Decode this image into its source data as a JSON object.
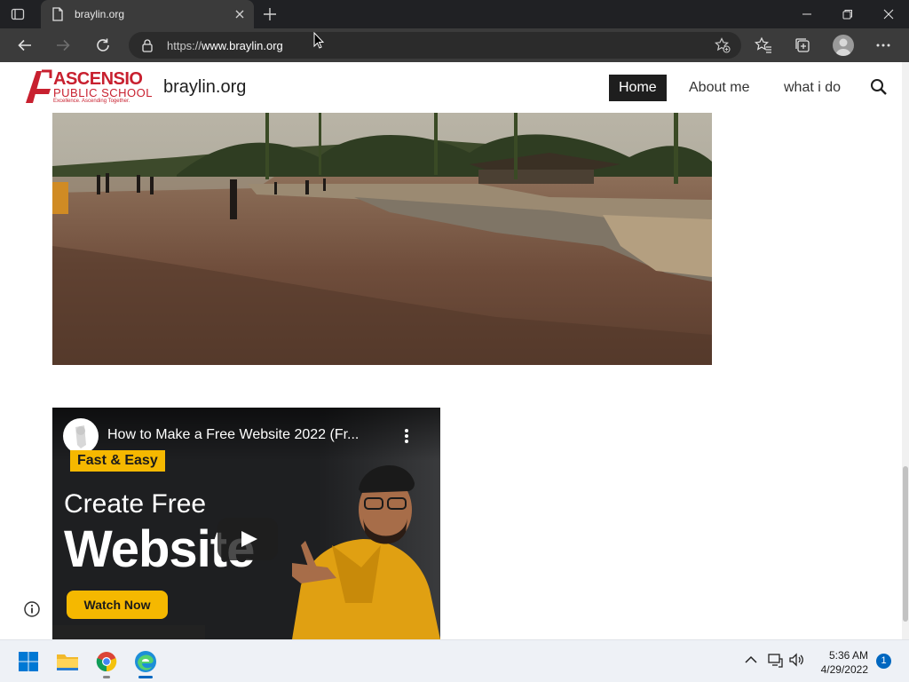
{
  "browser": {
    "tab_title": "braylin.org",
    "url_prefix": "https://",
    "url_host": "www.braylin.org"
  },
  "site": {
    "logo_line1": "ASCENSIO",
    "logo_line2": "PUBLIC SCHOOL",
    "logo_tagline": "Excellence. Ascending Together.",
    "title": "braylin.org",
    "nav": [
      {
        "label": "Home",
        "active": true
      },
      {
        "label": "About me",
        "active": false
      },
      {
        "label": "what i do",
        "active": false
      }
    ]
  },
  "video": {
    "title": "How to Make a Free Website 2022 (Fr...",
    "badge": "Fast & Easy",
    "line1": "Create Free",
    "line2": "Website",
    "cta": "Watch Now"
  },
  "taskbar": {
    "time": "5:36 AM",
    "date": "4/29/2022",
    "notifications": "1"
  },
  "colors": {
    "brand_red": "#c8202f",
    "accent_yellow": "#f5b800",
    "edge_blue": "#0067c0"
  }
}
